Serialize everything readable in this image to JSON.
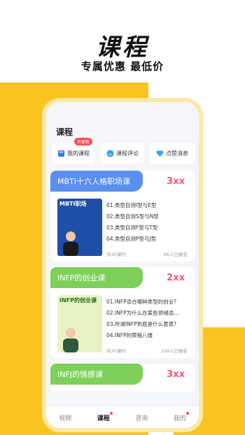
{
  "promo": {
    "title": "课程",
    "subtitle": "专属优惠 最低价"
  },
  "screen": {
    "title": "课程"
  },
  "quick_actions": [
    {
      "label": "我的课程",
      "icon": "book-icon",
      "badge": "有更新"
    },
    {
      "label": "课程评论",
      "icon": "smile-icon"
    },
    {
      "label": "点赞消息",
      "icon": "heart-icon"
    }
  ],
  "courses": [
    {
      "title": "MBTI十六人格职场课",
      "price": "3xx",
      "cover_title": "MBTI职场",
      "lessons": [
        "01.类型自测I型与E型",
        "02.类型自测S型与N型",
        "03.类型自测F型与T型",
        "04.类型自测P型与J型"
      ],
      "count": "共40课时",
      "enrolled": "66人已报名",
      "color": "#5a8ff0"
    },
    {
      "title": "INFP的创业课",
      "price": "2xx",
      "cover_title": "INFP的创业课",
      "lessons": [
        "01.INFP适合哪种类型的创业?",
        "02.INFP为什么在某些领域适…",
        "03.所谓INFP到底是什么意思?",
        "04.INFP的荣格八维"
      ],
      "count": "共30课时",
      "enrolled": "109人已报名",
      "color": "#7ed05a"
    },
    {
      "title": "INFJ的情感课",
      "price": "3xx",
      "color": "#7ed05a"
    }
  ],
  "tabs": [
    {
      "label": "视频",
      "active": false
    },
    {
      "label": "课程",
      "active": true
    },
    {
      "label": "咨询",
      "active": false
    },
    {
      "label": "我的",
      "active": false
    }
  ]
}
